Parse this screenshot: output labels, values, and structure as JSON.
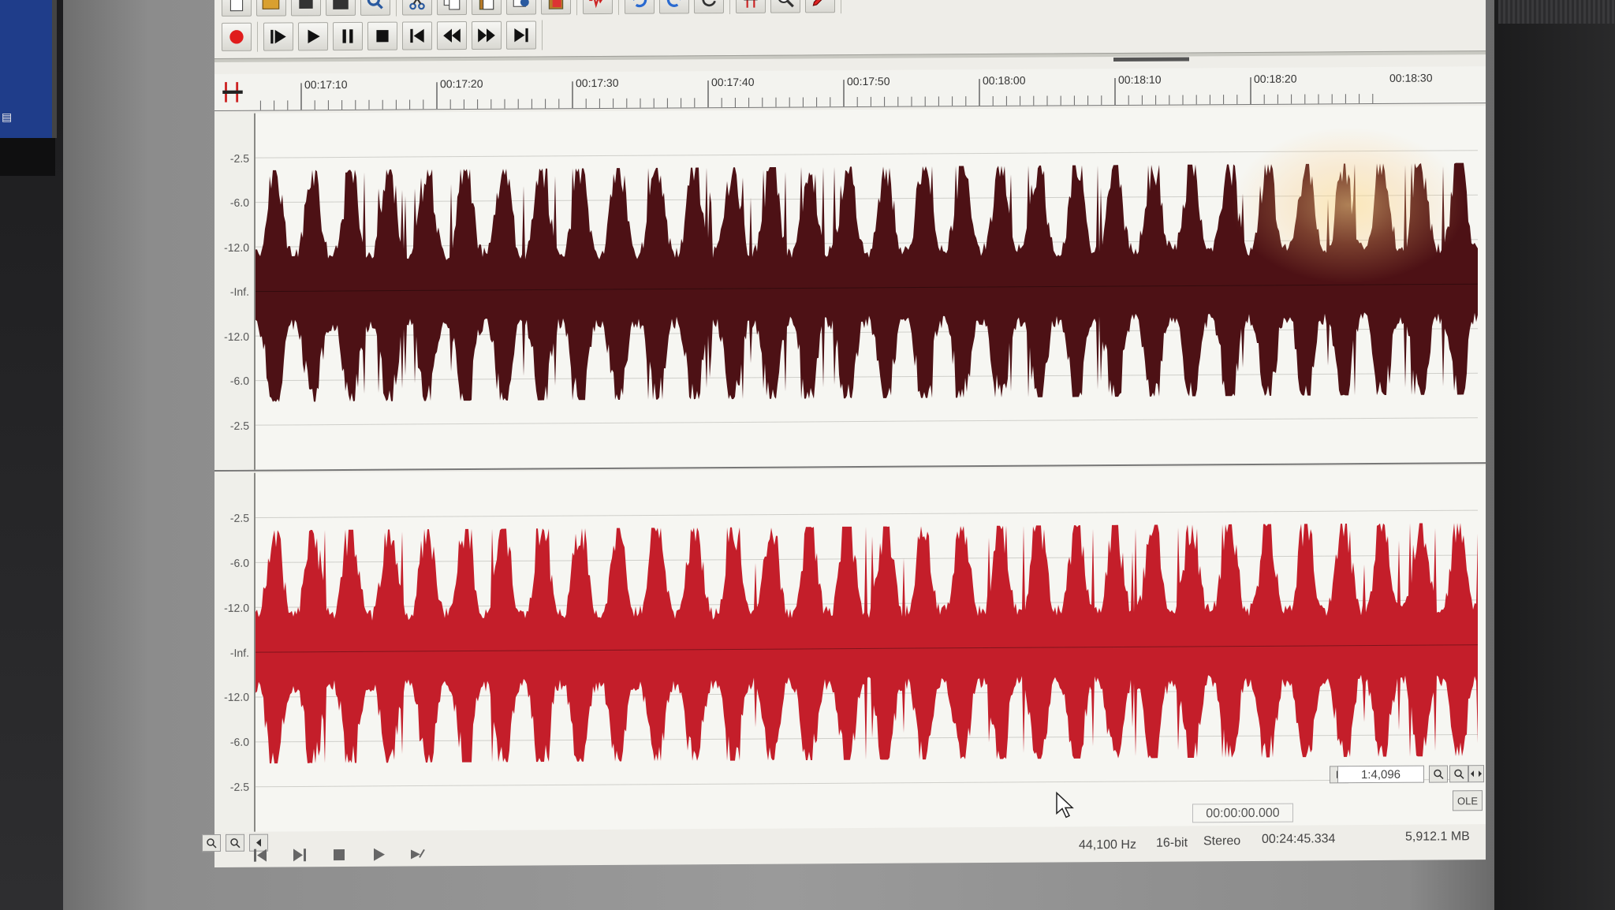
{
  "ruler": {
    "ticks": [
      "00:17:10",
      "00:17:20",
      "00:17:30",
      "00:17:40",
      "00:17:50",
      "00:18:00",
      "00:18:10",
      "00:18:20",
      "00:18:30"
    ]
  },
  "tracks": {
    "left": {
      "scale": [
        "-2.5",
        "-6.0",
        "-12.0",
        "-Inf.",
        "-12.0",
        "-6.0",
        "-2.5"
      ],
      "color": "#4d1115"
    },
    "right": {
      "scale": [
        "-2.5",
        "-6.0",
        "-12.0",
        "-Inf.",
        "-12.0",
        "-6.0",
        "-2.5"
      ],
      "color": "#c41e2a"
    }
  },
  "toolbar": {
    "edit_icons": [
      "new-file-icon",
      "open-folder-icon",
      "stop-square-icon",
      "save-icon",
      "properties-icon",
      "cut-icon",
      "copy-icon",
      "paste-icon",
      "paste-mix-icon",
      "paste-special-icon",
      "trim-icon",
      "undo-icon",
      "redo-icon",
      "repeat-icon",
      "marker-icon",
      "zoom-tool-icon",
      "pencil-icon"
    ],
    "transport_icons": [
      "record-icon",
      "play-from-start-icon",
      "play-icon",
      "pause-icon",
      "stop-icon",
      "go-to-start-icon",
      "rewind-icon",
      "fast-forward-icon",
      "go-to-end-icon"
    ]
  },
  "status": {
    "zoom": "1:4,096",
    "cursor_position": "00:00:00.000",
    "ole_label": "OLE",
    "sample_rate": "44,100 Hz",
    "bit_depth": "16-bit",
    "channels": "Stereo",
    "length": "00:24:45.334",
    "file_size": "5,912.1 MB"
  },
  "colors": {
    "screen_bg": "#f6f6f2",
    "bezel": "#8c8c8c",
    "left_channel": "#4d1115",
    "right_channel": "#c41e2a"
  }
}
